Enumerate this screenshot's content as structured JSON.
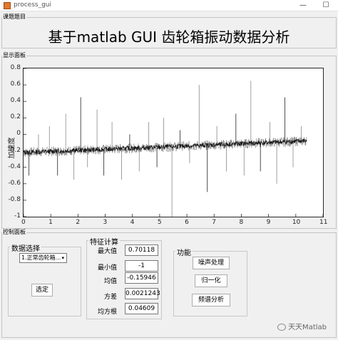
{
  "window": {
    "title": "process_gui",
    "minimize": "—",
    "maximize": "☐"
  },
  "title_panel": {
    "label": "课题题目",
    "title": "基于matlab GUI 齿轮箱振动数据分析"
  },
  "display_panel": {
    "label": "显示面板",
    "y_axis_label": "加速度",
    "y_ticks": [
      "0.8",
      "0.6",
      "0.4",
      "0.2",
      "0",
      "-0.2",
      "-0.4",
      "-0.6",
      "-0.8",
      "-1"
    ],
    "x_ticks": [
      "0",
      "1",
      "2",
      "3",
      "4",
      "5",
      "6",
      "7",
      "8",
      "9",
      "10",
      "11"
    ]
  },
  "chart_data": {
    "type": "line",
    "xlim": [
      0,
      11
    ],
    "ylim": [
      -1,
      0.8
    ],
    "ylabel": "加速度",
    "baseline": {
      "start": -0.22,
      "dip": -0.16,
      "end": -0.08,
      "x_end": 10.4
    },
    "spikes": [
      {
        "x": 0.2,
        "y": -0.5
      },
      {
        "x": 0.55,
        "y": 0.0
      },
      {
        "x": 0.95,
        "y": 0.1
      },
      {
        "x": 1.25,
        "y": -0.5
      },
      {
        "x": 1.55,
        "y": 0.25
      },
      {
        "x": 1.85,
        "y": -0.55
      },
      {
        "x": 2.1,
        "y": 0.45
      },
      {
        "x": 2.35,
        "y": -0.4
      },
      {
        "x": 2.7,
        "y": 0.3
      },
      {
        "x": 2.95,
        "y": -0.5
      },
      {
        "x": 3.25,
        "y": 0.15
      },
      {
        "x": 3.6,
        "y": -0.55
      },
      {
        "x": 3.9,
        "y": 0.0
      },
      {
        "x": 4.25,
        "y": -0.45
      },
      {
        "x": 4.6,
        "y": 0.15
      },
      {
        "x": 4.9,
        "y": -0.4
      },
      {
        "x": 5.15,
        "y": 0.2
      },
      {
        "x": 5.45,
        "y": -1.0
      },
      {
        "x": 5.75,
        "y": 0.05
      },
      {
        "x": 6.1,
        "y": -0.35
      },
      {
        "x": 6.45,
        "y": 0.6
      },
      {
        "x": 6.75,
        "y": -0.7
      },
      {
        "x": 7.1,
        "y": 0.1
      },
      {
        "x": 7.45,
        "y": -0.45
      },
      {
        "x": 7.8,
        "y": 0.25
      },
      {
        "x": 8.1,
        "y": -0.5
      },
      {
        "x": 8.35,
        "y": 0.65
      },
      {
        "x": 8.7,
        "y": -0.45
      },
      {
        "x": 9.05,
        "y": 0.15
      },
      {
        "x": 9.3,
        "y": -0.6
      },
      {
        "x": 9.6,
        "y": 0.45
      },
      {
        "x": 9.9,
        "y": -0.4
      },
      {
        "x": 10.2,
        "y": 0.1
      }
    ]
  },
  "control_panel": {
    "label": "控制面板",
    "data_select": {
      "label": "数据选择",
      "selected": "1.正常齿轮箱...",
      "confirm_button": "选定"
    },
    "features": {
      "label": "特征计算",
      "rows": [
        {
          "name": "最大值",
          "value": "0.70118"
        },
        {
          "name": "最小值",
          "value": "-1"
        },
        {
          "name": "均值",
          "value": "-0.15946"
        },
        {
          "name": "方差",
          "value": "0.0021243"
        },
        {
          "name": "均方根",
          "value": "0.04609"
        }
      ]
    },
    "functions": {
      "label": "功能",
      "denoise_button": "噪声处理",
      "normalize_button": "归一化",
      "spectrum_button": "频谱分析"
    }
  },
  "watermark": {
    "text": "天天Matlab"
  }
}
